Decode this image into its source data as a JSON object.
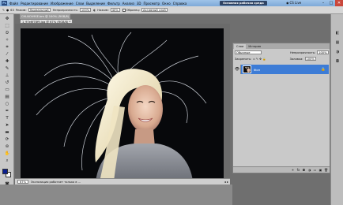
{
  "app": {
    "logo": "Ps",
    "menu": [
      "Файл",
      "Редактирование",
      "Изображение",
      "Слои",
      "Выделение",
      "Фильтр",
      "Анализ",
      "3D",
      "Просмотр",
      "Окно",
      "Справка"
    ],
    "zoom": "67%",
    "workspace": "Основная рабочая среда",
    "cs_live": "CS Live",
    "window_controls": [
      "–",
      "□",
      "✕"
    ]
  },
  "options_bar": {
    "brush_size": "63",
    "mode_label": "Режим:",
    "mode_value": "Нормальный",
    "opacity_label": "Непрозрачность:",
    "opacity_value": "100%",
    "pressure_label": "Нажим:",
    "pressure_value": "40%",
    "sample_all_layers": "Образец:",
    "sample_value": "Активный слой"
  },
  "documents": {
    "inactive_tab": "CHLNOV9SE.bm @ 100% (RGB/8)",
    "active_tab": "1_97e6f78f9.jpg @ 67% (RGB/8) *"
  },
  "status": {
    "zoom": "67%",
    "info": "Экспозиция работает только в ...",
    "scroll_arrows": "◂ ▸"
  },
  "layers_panel": {
    "tabs": [
      "Слои",
      "История"
    ],
    "blend_mode": "Обычные",
    "opacity_label": "Непрозрачность:",
    "opacity_value": "100%",
    "lock_label": "Закрепить:",
    "fill_label": "Заливка:",
    "fill_value": "100%",
    "layer_name": "Фон",
    "footer_icons": [
      "link-icon",
      "fx-icon",
      "mask-icon",
      "adjustment-icon",
      "folder-icon",
      "new-layer-icon",
      "trash-icon"
    ]
  },
  "tools": [
    "move",
    "marquee",
    "lasso",
    "quick-select",
    "crop",
    "eyedropper",
    "healing",
    "brush",
    "clone",
    "history-brush",
    "eraser",
    "gradient",
    "dodge",
    "pen",
    "type",
    "path-select",
    "shape",
    "3d-rotate",
    "3d-orbit",
    "hand",
    "zoom"
  ],
  "colors": {
    "foreground": "#0b1f8f",
    "background": "#ffffff",
    "selected_layer": "#3d7cd6"
  }
}
